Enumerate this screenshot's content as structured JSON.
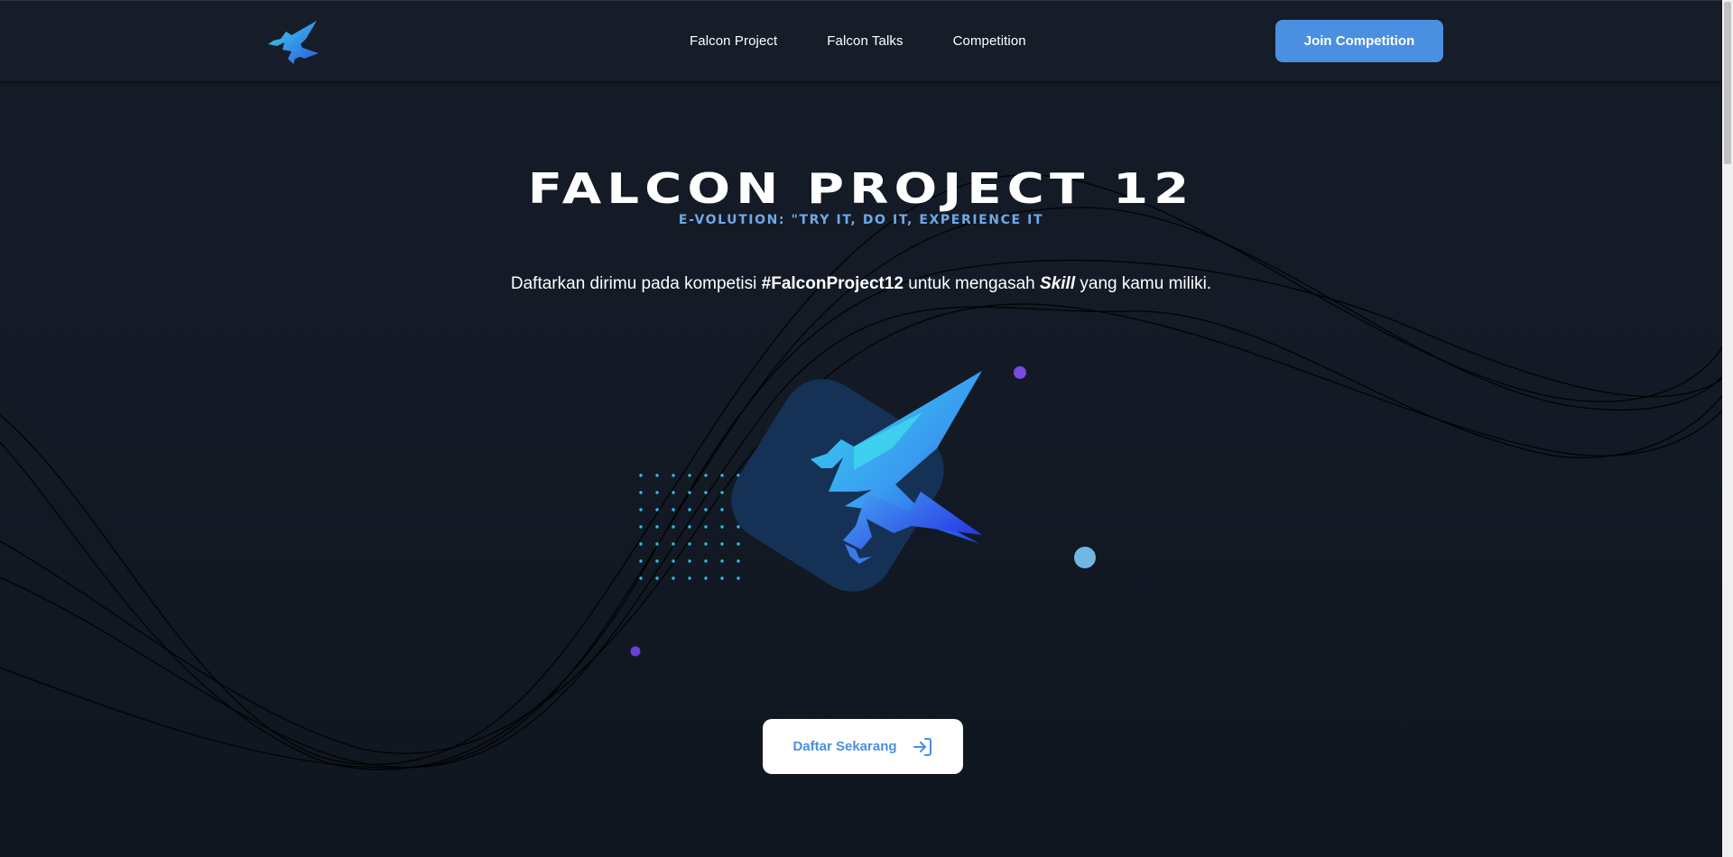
{
  "nav": {
    "logo_icon": "falcon-logo-icon",
    "links": [
      {
        "label": "Falcon Project"
      },
      {
        "label": "Falcon Talks"
      },
      {
        "label": "Competition"
      }
    ],
    "join_button": "Join Competition"
  },
  "hero": {
    "title": "Falcon Project 12",
    "subtitle": "E-volution: \"Try it, Do it, Experience it",
    "description": {
      "part1": "Daftarkan dirimu pada kompetisi ",
      "hashtag": "#FalconProject12",
      "part2": " untuk mengasah ",
      "skill": "Skill",
      "part3": " yang kamu miliki."
    },
    "illustration_icon": "falcon-emblem-icon",
    "cta_label": "Daftar Sekarang",
    "cta_icon": "login-arrow-icon"
  },
  "colors": {
    "background": "#131a25",
    "accent": "#4a8fe0",
    "subtitle": "#6fa9e8",
    "emblem_bg": "#153256",
    "dot_pattern": "#2bbfe6",
    "purple_dot": "#7b48e0",
    "light_blue_dot": "#6fb8e4"
  }
}
